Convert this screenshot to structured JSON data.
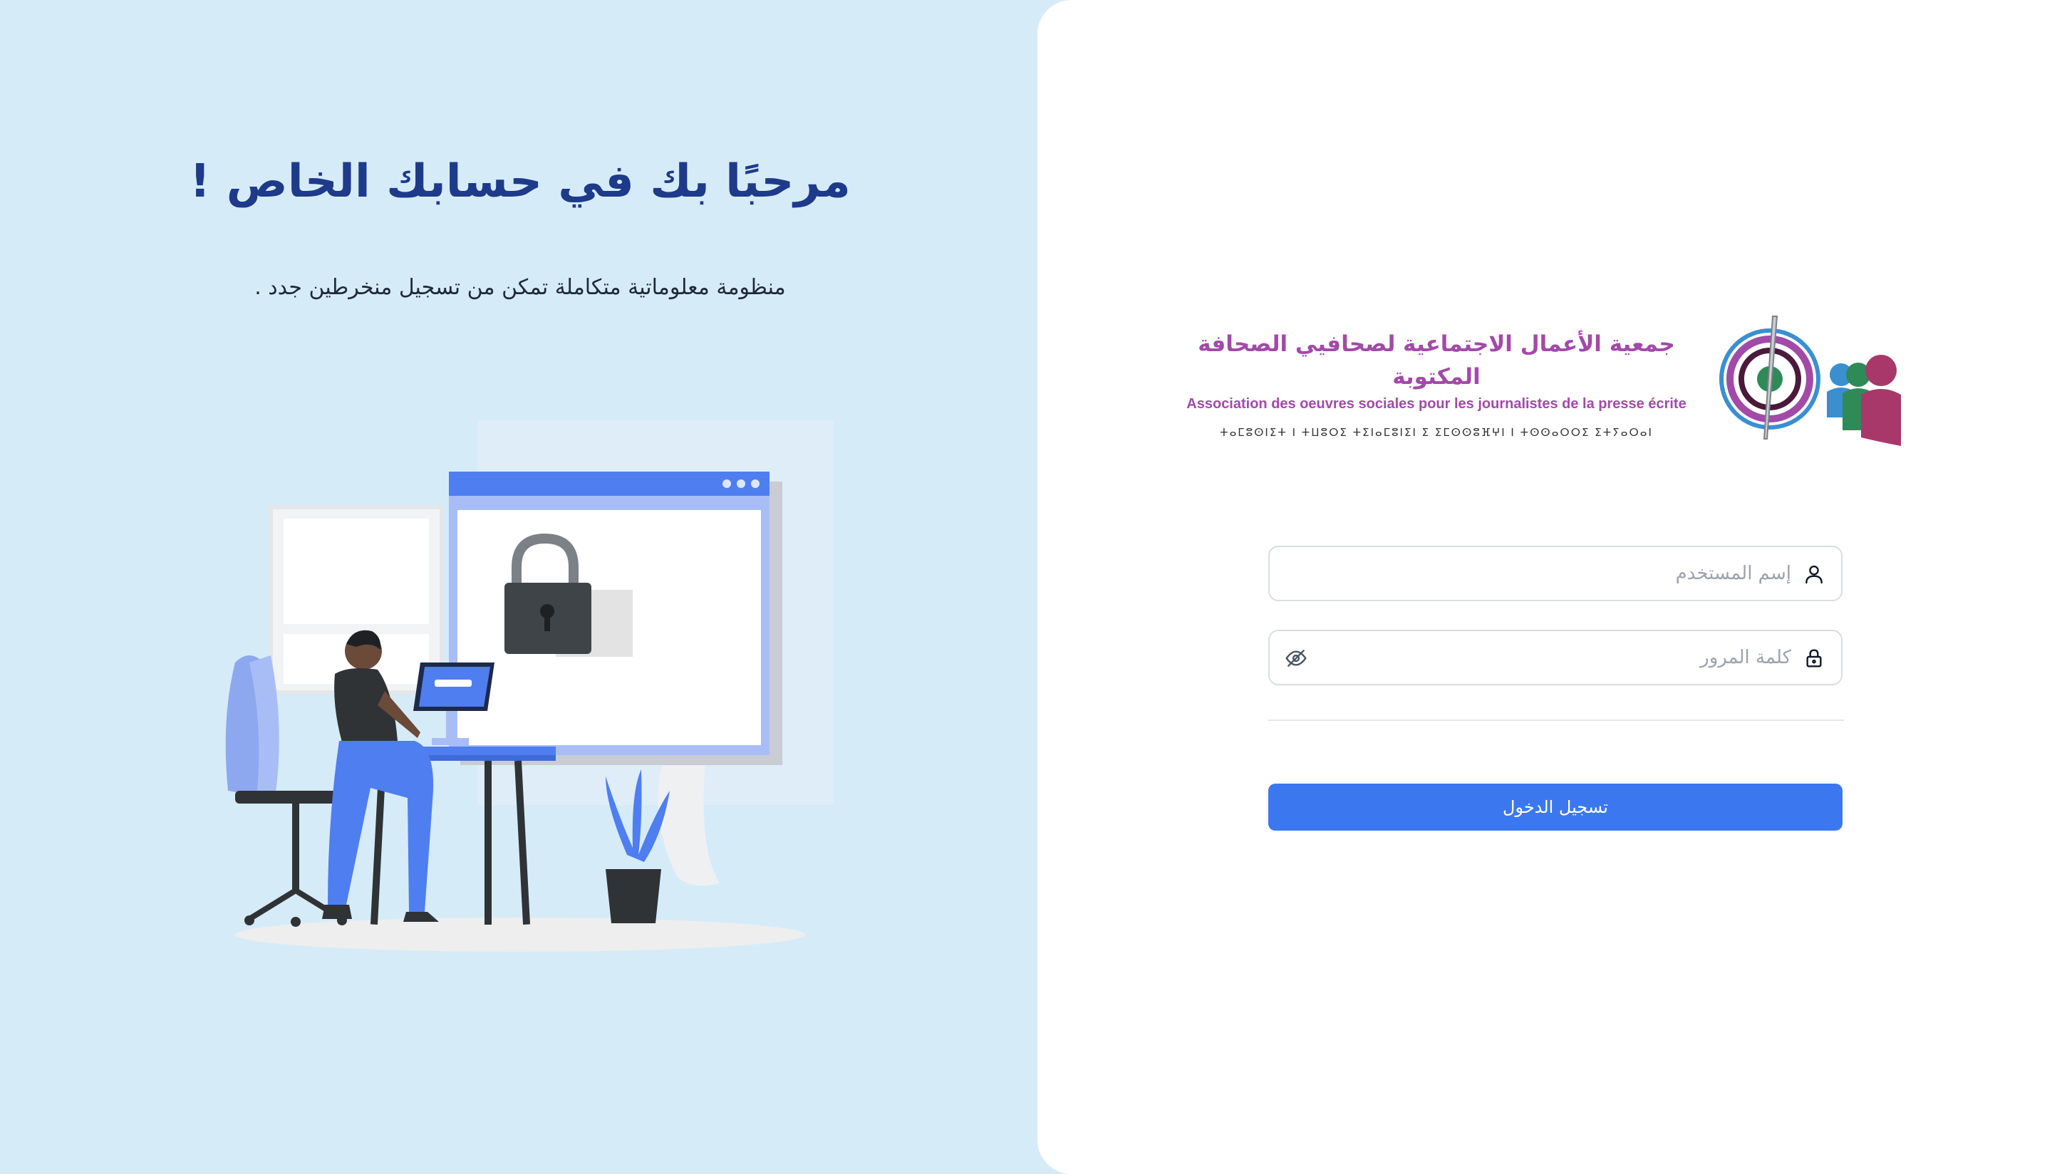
{
  "welcome": {
    "title": "مرحبًا بك في حسابك الخاص !",
    "subtitle": "منظومة معلوماتية متكاملة تمكن من تسجيل منخرطين جدد ."
  },
  "logo": {
    "arabic_name": "جمعية الأعمال الاجتماعية لصحافيي الصحافة المكتوبة",
    "french_name": "Association des oeuvres sociales pour les journalistes de la presse écrite",
    "tifinagh_name": "ⵜⴰⵎⵓⵙⵏⵉⵜ ⵏ ⵜⵡⵓⵔⵉ ⵜⵉⵏⴰⵎⵓⵏⵉⵏ ⵉ ⵉⵎⵙⵙⵓⴼⵖⵏ ⵏ ⵜⵙⵙⴰⵔⵔⵉ ⵉⵜⵢⴰⵔⴰⵏ"
  },
  "form": {
    "username": {
      "placeholder": "إسم المستخدم",
      "value": "",
      "icon": "user-icon"
    },
    "password": {
      "placeholder": "كلمة المرور",
      "value": "",
      "icon": "lock-icon",
      "toggle_icon": "eye-off-icon"
    },
    "submit_label": "تسجيل الدخول"
  },
  "colors": {
    "left_background": "#d6ebf8",
    "title": "#1e3a8a",
    "logo_text": "#a24aa8",
    "button": "#3b78f0"
  }
}
